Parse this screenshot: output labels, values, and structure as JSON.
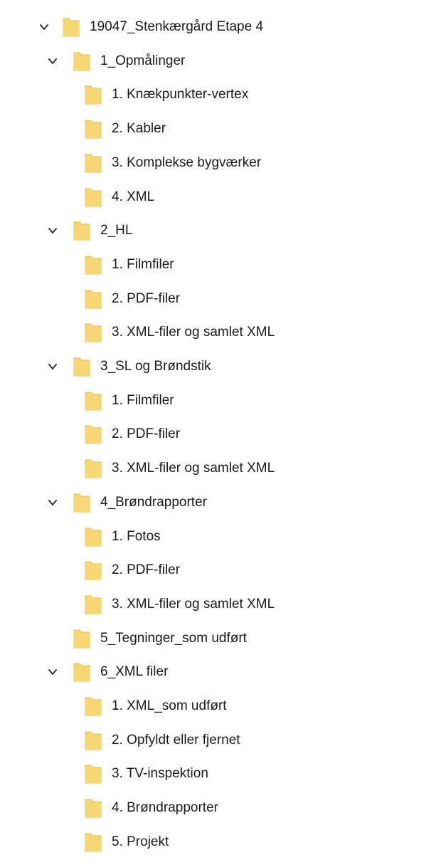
{
  "tree": {
    "root": {
      "label": "19047_Stenkærgård Etape 4",
      "expanded": true,
      "children": [
        {
          "label": "1_Opmålinger",
          "expanded": true,
          "children": [
            {
              "label": "1. Knækpunkter-vertex"
            },
            {
              "label": "2. Kabler"
            },
            {
              "label": "3. Komplekse bygværker"
            },
            {
              "label": "4. XML"
            }
          ]
        },
        {
          "label": "2_HL",
          "expanded": true,
          "children": [
            {
              "label": "1. Filmfiler"
            },
            {
              "label": "2. PDF-filer"
            },
            {
              "label": "3. XML-filer og samlet XML"
            }
          ]
        },
        {
          "label": "3_SL og Brøndstik",
          "expanded": true,
          "children": [
            {
              "label": "1. Filmfiler"
            },
            {
              "label": "2. PDF-filer"
            },
            {
              "label": "3. XML-filer og samlet XML"
            }
          ]
        },
        {
          "label": "4_Brøndrapporter",
          "expanded": true,
          "children": [
            {
              "label": "1. Fotos"
            },
            {
              "label": "2. PDF-filer"
            },
            {
              "label": "3. XML-filer og samlet XML"
            }
          ]
        },
        {
          "label": "5_Tegninger_som udført",
          "expanded": false,
          "children": []
        },
        {
          "label": "6_XML filer",
          "expanded": true,
          "children": [
            {
              "label": "1. XML_som udført"
            },
            {
              "label": "2. Opfyldt eller fjernet"
            },
            {
              "label": "3. TV-inspektion"
            },
            {
              "label": "4. Brøndrapporter"
            },
            {
              "label": "5. Projekt"
            }
          ]
        }
      ]
    },
    "colors": {
      "folder_body": "#f8d775",
      "folder_edge": "#e4b94d",
      "chevron": "#333333",
      "text": "#1a1a1a"
    },
    "icons": {
      "expanded": "chevron-down-icon",
      "folder": "folder-icon"
    }
  }
}
